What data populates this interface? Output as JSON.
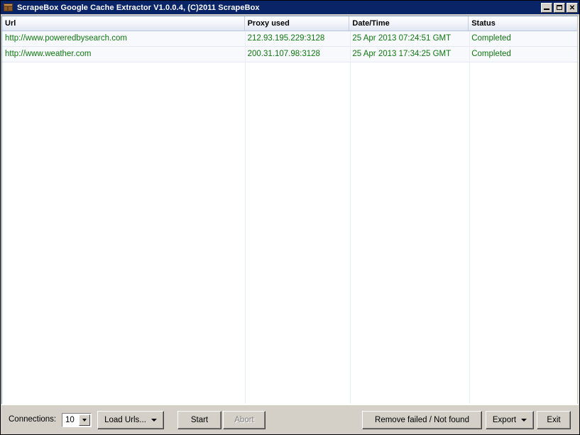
{
  "window": {
    "title": "ScrapeBox Google Cache Extractor V1.0.0.4, (C)2011 ScrapeBox",
    "icon": "scrapebox-box-icon",
    "buttons": {
      "minimize": "_",
      "maximize": "□",
      "close": "✕"
    },
    "colors": {
      "titlebar": "#0a2468",
      "face": "#d4d0c8",
      "row_text": "#117711",
      "header_text": "#000000"
    }
  },
  "list": {
    "columns": [
      {
        "key": "url",
        "label": "Url"
      },
      {
        "key": "proxy",
        "label": "Proxy used"
      },
      {
        "key": "datetime",
        "label": "Date/Time"
      },
      {
        "key": "status",
        "label": "Status"
      }
    ],
    "rows": [
      {
        "url": "http://www.poweredbysearch.com",
        "proxy": "212.93.195.229:3128",
        "datetime": "25 Apr 2013 07:24:51 GMT",
        "status": "Completed"
      },
      {
        "url": "http://www.weather.com",
        "proxy": "200.31.107.98:3128",
        "datetime": "25 Apr 2013 17:34:25 GMT",
        "status": "Completed"
      }
    ]
  },
  "toolbar": {
    "connections_label": "Connections:",
    "connections_value": "10",
    "load_urls_label": "Load Urls...",
    "start_label": "Start",
    "abort_label": "Abort",
    "abort_enabled": false,
    "remove_failed_label": "Remove failed / Not found",
    "export_label": "Export",
    "exit_label": "Exit"
  }
}
